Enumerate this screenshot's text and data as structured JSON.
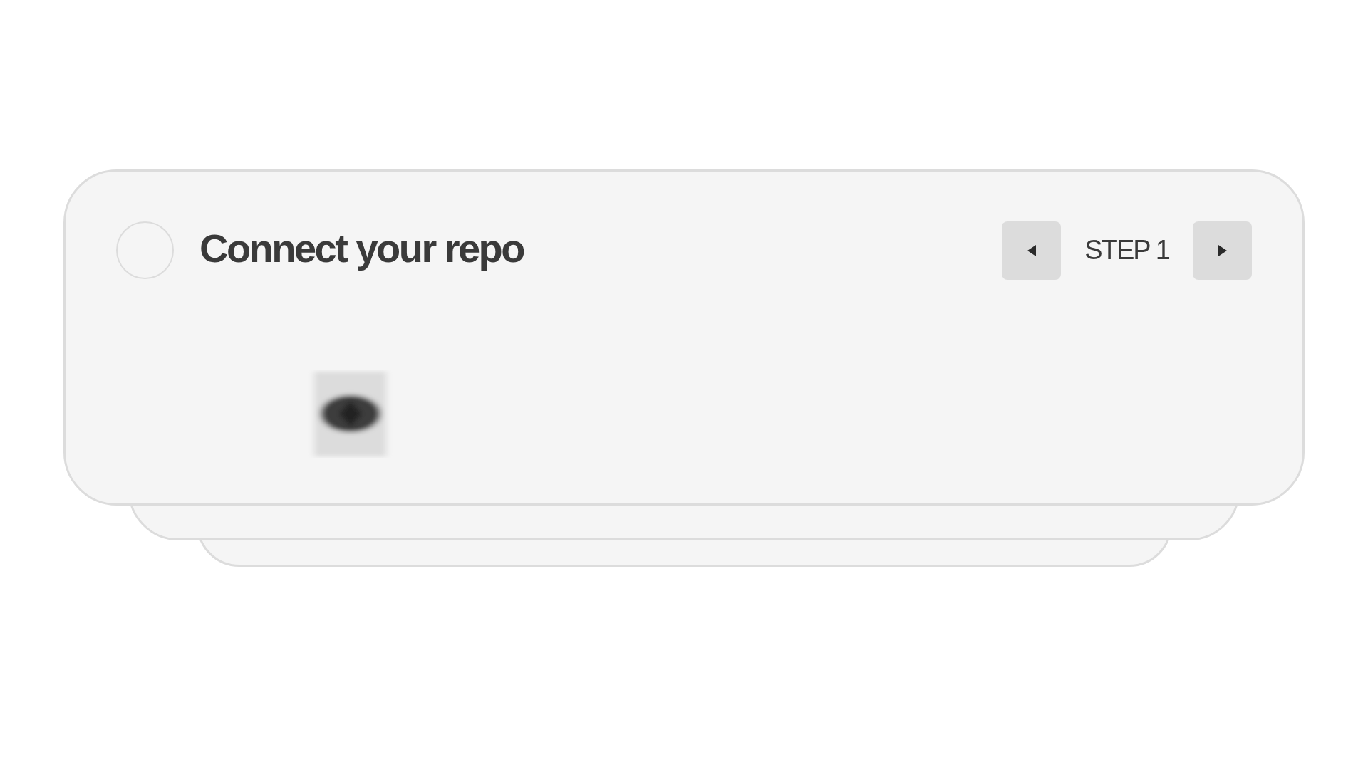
{
  "step_card": {
    "title": "Connect your repo",
    "completed": false,
    "step_label": "STEP 1"
  }
}
